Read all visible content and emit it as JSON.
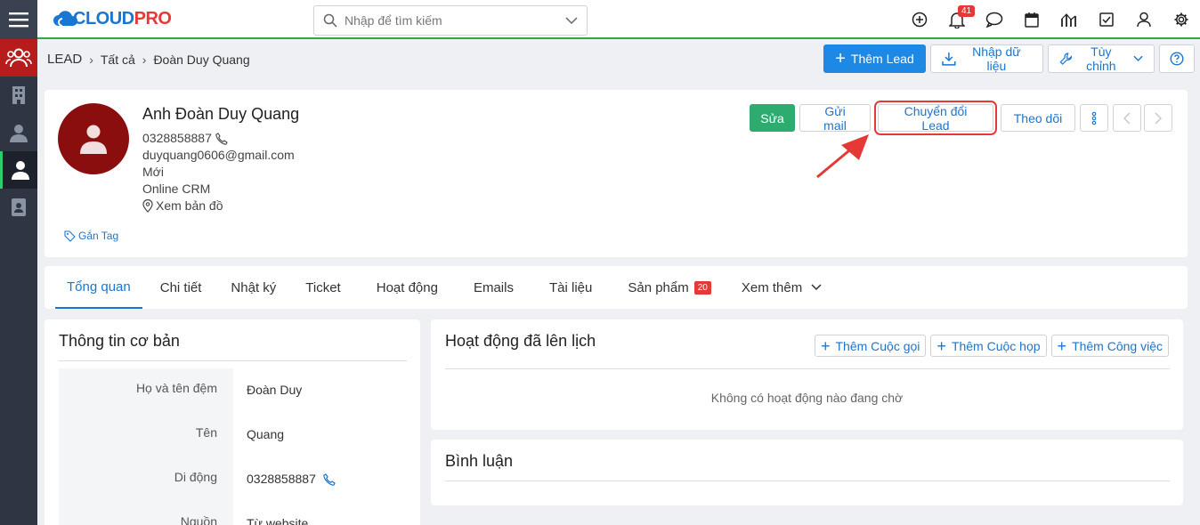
{
  "app": {
    "logo_text_a": "CLOUD",
    "logo_text_b": "PRO"
  },
  "search": {
    "placeholder": "Nhập để tìm kiếm"
  },
  "topbar": {
    "notification_count": "41"
  },
  "breadcrumb": {
    "module": "LEAD",
    "filter": "Tất cả",
    "record": "Đoàn Duy Quang"
  },
  "header_actions": {
    "add": "Thêm Lead",
    "import": "Nhập dữ liệu",
    "customize": "Tùy chỉnh"
  },
  "profile": {
    "name": "Anh Đoàn Duy Quang",
    "phone": "0328858887",
    "email": "duyquang0606@gmail.com",
    "status": "Mới",
    "source": "Online CRM",
    "map": "Xem bản đồ",
    "tag": "Gắn Tag",
    "actions": {
      "edit": "Sửa",
      "send_mail": "Gửi mail",
      "convert": "Chuyển đổi Lead",
      "follow": "Theo dõi"
    }
  },
  "tabs": [
    {
      "label": "Tổng quan"
    },
    {
      "label": "Chi tiết"
    },
    {
      "label": "Nhật ký"
    },
    {
      "label": "Ticket"
    },
    {
      "label": "Hoạt động"
    },
    {
      "label": "Emails"
    },
    {
      "label": "Tài liệu"
    },
    {
      "label": "Sản phẩm",
      "count": "20"
    },
    {
      "label": "Xem thêm"
    }
  ],
  "basic_info": {
    "title": "Thông tin cơ bản",
    "fields": [
      {
        "label": "Họ và tên đệm",
        "value": "Đoàn Duy"
      },
      {
        "label": "Tên",
        "value": "Quang"
      },
      {
        "label": "Di động",
        "value": "0328858887"
      },
      {
        "label": "Nguồn",
        "value": "Từ website"
      }
    ]
  },
  "activities": {
    "title": "Hoạt động đã lên lịch",
    "add_call": "Thêm Cuộc gọi",
    "add_meeting": "Thêm Cuộc họp",
    "add_task": "Thêm Công việc",
    "empty": "Không có hoạt động nào đang chờ"
  },
  "comments": {
    "title": "Bình luận"
  },
  "colors": {
    "primary": "#1e88e5",
    "green": "#2eab6e",
    "red": "#e53935",
    "avatar": "#8b0e0e",
    "rail": "#2f3542"
  }
}
